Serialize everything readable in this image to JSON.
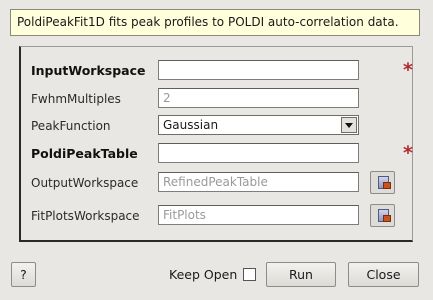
{
  "description": "PoldiPeakFit1D fits peak profiles to POLDI auto-correlation data.",
  "fields": [
    {
      "label": "InputWorkspace",
      "value": "",
      "placeholder": "",
      "required": true
    },
    {
      "label": "FwhmMultiples",
      "value": "",
      "placeholder": "2"
    },
    {
      "label": "PeakFunction",
      "value": "Gaussian"
    },
    {
      "label": "PoldiPeakTable",
      "value": "",
      "placeholder": "",
      "required": true
    },
    {
      "label": "OutputWorkspace",
      "value": "",
      "placeholder": "RefinedPeakTable"
    },
    {
      "label": "FitPlotsWorkspace",
      "value": "",
      "placeholder": "FitPlots"
    }
  ],
  "required_mark": "*",
  "footer": {
    "help_label": "?",
    "keep_open_label": "Keep Open",
    "keep_open_checked": false,
    "run_label": "Run",
    "close_label": "Close"
  },
  "icons": {
    "required": "asterisk-icon",
    "browse": "browse-workspace-icon",
    "dropdown": "chevron-down-icon"
  },
  "colors": {
    "description_bg": "#ffffdc",
    "required_mark": "#b3282d",
    "window_bg": "#e9e7e3"
  }
}
